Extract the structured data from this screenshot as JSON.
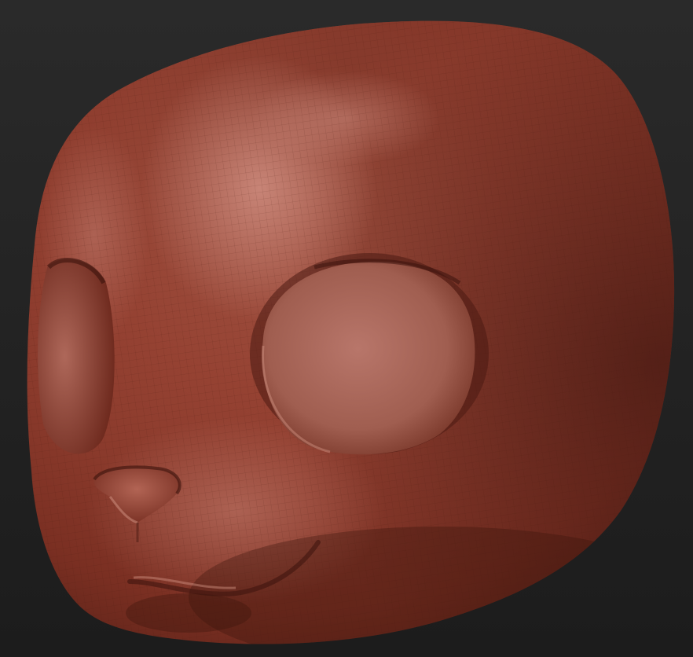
{
  "viewport": {
    "background_top": "#282828",
    "background_bottom": "#1e1e1e"
  },
  "model": {
    "subject": "sculpted-creature-head-icon",
    "material": {
      "base": "#8e3f2e",
      "highlight": "#c07a68",
      "shadow": "#3e1610",
      "wireframe": "#4a1c12"
    },
    "features": [
      "head",
      "left-eye-socket",
      "right-eye-socket",
      "nose",
      "mouth",
      "cheek",
      "brow"
    ]
  }
}
